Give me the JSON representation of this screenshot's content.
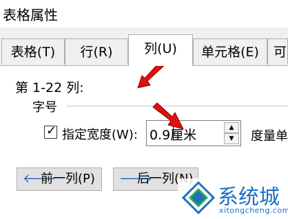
{
  "window": {
    "title": "表格属性"
  },
  "tabs": [
    {
      "label": "表格(T)",
      "active": false
    },
    {
      "label": "行(R)",
      "active": false
    },
    {
      "label": "列(U)",
      "active": true
    },
    {
      "label": "单元格(E)",
      "active": false
    },
    {
      "label": "可",
      "active": false
    }
  ],
  "column": {
    "range_label": "第 1-22 列:",
    "group_label": "字号",
    "checkbox": {
      "checked": true,
      "label": "指定宽度(W):"
    },
    "width": {
      "value": "0.9厘米"
    },
    "measure_label": "度量单"
  },
  "buttons": {
    "prev": "前一列(P)",
    "next": "后一列(N)"
  },
  "watermark": {
    "text": "系统城",
    "url": "xitongcheng.com"
  },
  "colors": {
    "arrow": "#e01010",
    "accent": "#1b6fc6"
  }
}
